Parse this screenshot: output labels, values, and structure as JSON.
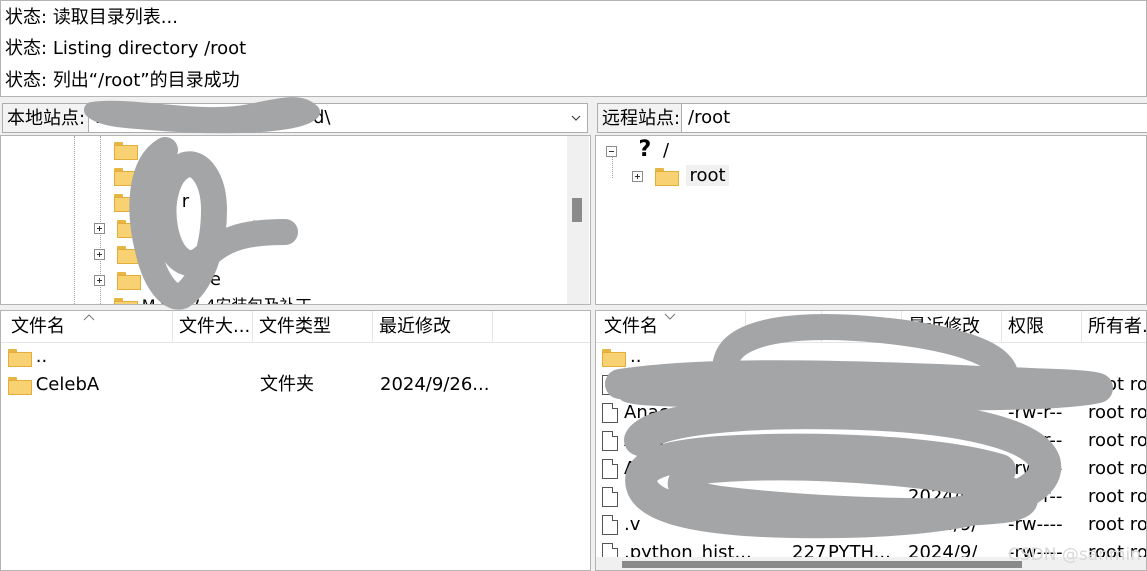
{
  "log": [
    {
      "label": "状态:",
      "text": "读取目录列表..."
    },
    {
      "label": "状态:",
      "text": "Listing directory /root"
    },
    {
      "label": "状态:",
      "text": "列出“/root”的目录成功"
    }
  ],
  "local": {
    "site_label": "本地站点:",
    "path_visible_start": "D:\\",
    "path_visible_end": "d\\",
    "tree": {
      "rows": [
        {
          "text": "",
          "expander": ""
        },
        {
          "text": "",
          "expander": ""
        },
        {
          "text": "r",
          "expander": ""
        },
        {
          "text": "sto",
          "expander": "plus"
        },
        {
          "text": "",
          "expander": "plus"
        },
        {
          "text": "ge",
          "expander": "plus"
        },
        {
          "text": "M       ype7.4安装包及补丁",
          "expander": ""
        }
      ]
    },
    "files": {
      "headers": [
        "文件名",
        "文件大...",
        "文件类型",
        "最近修改"
      ],
      "rows": [
        {
          "name": "..",
          "size": "",
          "type": "",
          "modified": ""
        },
        {
          "name": "CelebA",
          "size": "",
          "type": "文件夹",
          "modified": "2024/9/26..."
        }
      ]
    }
  },
  "remote": {
    "site_label": "远程站点:",
    "path": "/root",
    "tree": {
      "root": "/",
      "child": "root",
      "unknown_icon": "question-mark-icon"
    },
    "files": {
      "headers": [
        "文件名",
        "",
        "",
        "最近修改",
        "权限",
        "所有者..."
      ],
      "rows": [
        {
          "name": "..",
          "size": "",
          "type": "",
          "modified": "",
          "perms": "",
          "owner": "",
          "icon": "folder"
        },
        {
          "name": "A",
          "size": "",
          "type": "",
          "modified": "",
          "perms": "",
          "owner": "root ro",
          "icon": "file"
        },
        {
          "name": "Anacond",
          "size": "",
          "type": "",
          "modified": "",
          "perms": "-rw-r--",
          "owner": "root ro",
          "icon": "file"
        },
        {
          "name": "A        da",
          "size": "",
          "type": "",
          "modified": "",
          "perms": "-rw-r--",
          "owner": "root ro",
          "icon": "file"
        },
        {
          "name": "A    c",
          "size": "",
          "type": "",
          "modified": "",
          "perms": "-rw-r--",
          "owner": "root ro",
          "icon": "file"
        },
        {
          "name": "    et",
          "size": "",
          "type": "",
          "modified": "2024/9/",
          "perms": "-rw-r--",
          "owner": "root ro",
          "icon": "file"
        },
        {
          "name": ".v",
          "size": "",
          "type": "",
          "modified": "2024/9/",
          "perms": "-rw----",
          "owner": "root ro",
          "icon": "file"
        },
        {
          "name": ".python_hist...",
          "size": "227",
          "type": "PYTH...",
          "modified": "2024/9/",
          "perms": "-rw----",
          "owner": "root ro",
          "icon": "file"
        }
      ]
    }
  },
  "watermark": "CSDN @sanmin",
  "colors": {
    "scribble": "#a4a5a7",
    "folder": "#f8d272",
    "chrome": "#f0f0f0"
  }
}
